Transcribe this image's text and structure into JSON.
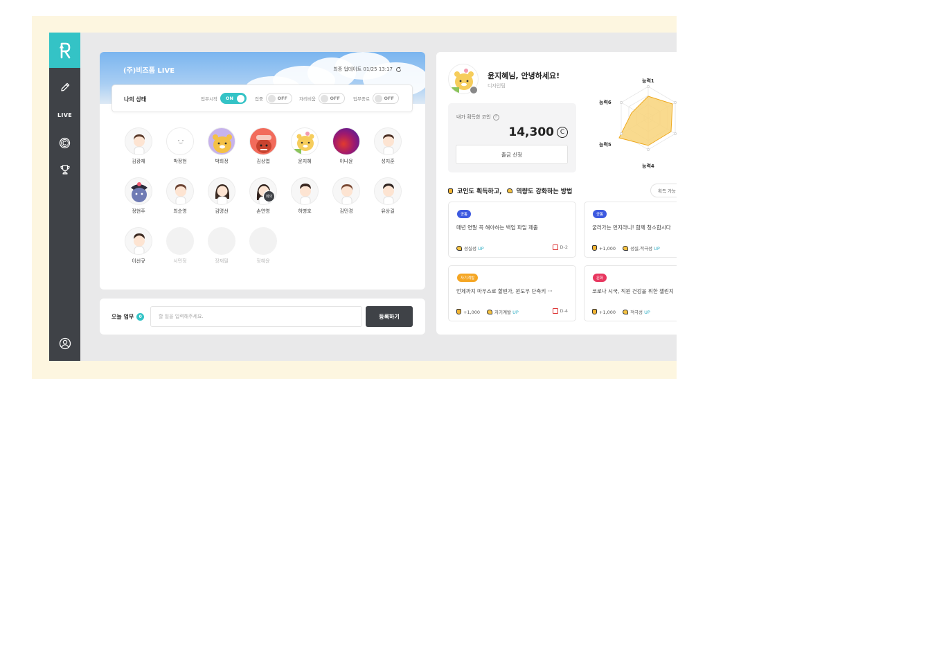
{
  "nav": {
    "live_label": "LIVE"
  },
  "live": {
    "title": "(주)비즈폼 LIVE",
    "updated": "최종 업데이트 01/25 13:17"
  },
  "status": {
    "label": "나의 상태",
    "toggles": [
      {
        "name": "업무시작",
        "state": "ON"
      },
      {
        "name": "집중",
        "state": "OFF"
      },
      {
        "name": "자리비움",
        "state": "OFF"
      },
      {
        "name": "업무종료",
        "state": "OFF"
      }
    ]
  },
  "members": [
    {
      "name": "김광재",
      "active": true
    },
    {
      "name": "박정현",
      "active": true
    },
    {
      "name": "박희정",
      "active": true
    },
    {
      "name": "김상엽",
      "active": true
    },
    {
      "name": "윤지혜",
      "active": true
    },
    {
      "name": "이나윤",
      "active": true
    },
    {
      "name": "성지훈",
      "active": true
    },
    {
      "name": "정현주",
      "active": true
    },
    {
      "name": "최순영",
      "active": true
    },
    {
      "name": "김명선",
      "active": true
    },
    {
      "name": "손연영",
      "active": true
    },
    {
      "name": "하병호",
      "active": true
    },
    {
      "name": "김민경",
      "active": true
    },
    {
      "name": "유상길",
      "active": true
    },
    {
      "name": "이선규",
      "active": true
    },
    {
      "name": "서민정",
      "active": false
    },
    {
      "name": "장재필",
      "active": false
    },
    {
      "name": "정혜윤",
      "active": false
    }
  ],
  "meeting_badge": "회의",
  "task": {
    "label": "오늘 업무",
    "count": "0",
    "placeholder": "할 일을 입력해주세요.",
    "submit": "등록하기"
  },
  "profile": {
    "greeting": "윤지혜님, 안녕하세요!",
    "team": "디자인팀",
    "coin_label": "내가 획득한 코인",
    "help": "?",
    "coin_value": "14,300",
    "coin_symbol": "C",
    "withdraw": "출금 신청"
  },
  "radar": {
    "labels": [
      "능력1",
      "능력6",
      "능력5",
      "능력4"
    ]
  },
  "howto": {
    "part1": "코인도 획득하고,",
    "part2": "역량도 강화하는 방법",
    "filter": "획득 가능"
  },
  "missions": [
    {
      "tag": "공통",
      "tag_color": "#3d5ae0",
      "title": "매년 연말 꼭 해야하는 백업 파일 제출",
      "reward": "",
      "skill": "성실성",
      "up": "UP",
      "dday": "D-2"
    },
    {
      "tag": "공통",
      "tag_color": "#3d5ae0",
      "title": "굴러가는 먼지라니! 함께 청소합시다",
      "reward": "+1,000",
      "skill": "성실,적극성",
      "up": "UP",
      "dday": ""
    },
    {
      "tag": "자기계발",
      "tag_color": "#f5a623",
      "title": "언제까지 마우스로 할텐가, 윈도우 단축키 ···",
      "reward": "+1,000",
      "skill": "자기계발",
      "up": "UP",
      "dday": "D-4"
    },
    {
      "tag": "문화",
      "tag_color": "#e8375f",
      "title": "코로나 시국, 직원 건강을 위한 챌린지",
      "reward": "+1,000",
      "skill": "적극성",
      "up": "UP",
      "dday": ""
    }
  ],
  "colors": {
    "accent": "#34c3c6",
    "sidebar": "#3f4247",
    "frame": "#fdf6e0",
    "radar_fill": "#f8d37a",
    "radar_stroke": "#eea81c"
  }
}
